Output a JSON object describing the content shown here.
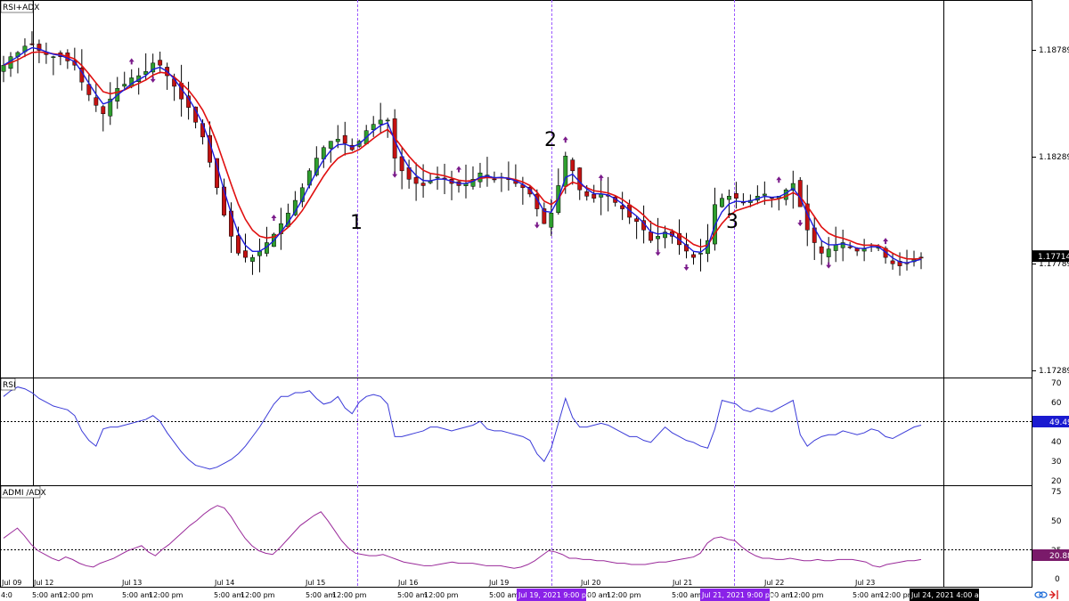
{
  "panels": {
    "main_title": "RSI+ADX",
    "rsi_title": "RSI",
    "adx_title": "ADMI /ADX"
  },
  "annotations": [
    "1",
    "2",
    "3"
  ],
  "colors": {
    "bull": "#2e9e2e",
    "bear": "#c31212",
    "fast_ma": "#1a1adc",
    "slow_ma": "#e01010",
    "rsi_line": "#3a3ad8",
    "adx_line": "#9a2a9a",
    "arrow": "#7a1a8a",
    "vline_dashed": "#9b59ff",
    "current_price_bg": "#000000",
    "rsi_value_bg": "#1a1ad0",
    "adx_value_bg": "#7a1a6a",
    "time_highlight_bg": "#8a22e8"
  },
  "time_axis": {
    "date_labels": [
      "Jul 09",
      "Jul 12",
      "Jul 13",
      "Jul 14",
      "Jul 15",
      "Jul 16",
      "Jul 19",
      "Jul 20",
      "Jul 21",
      "Jul 22",
      "Jul 23"
    ],
    "time_labels": [
      "4:0",
      "5:00 am",
      "12:00 pm",
      "5:00 am",
      "12:00 pm",
      "5:00 am",
      "12:00 pm",
      "5:00 am",
      "12:00 pm",
      "5:00 am",
      "12:00 pm",
      "5:00 am",
      "00 am",
      "12:00 pm",
      "5:00 am",
      "00 am",
      "12:00 pm",
      "5:00 am",
      "12:00 pm"
    ],
    "highlighted_times": [
      "Jul 19, 2021 9:00 pm",
      "Jul 21, 2021 9:00 pm",
      "Jul 24, 2021 4:00 am"
    ]
  },
  "chart_data": [
    {
      "type": "candlestick",
      "title": "RSI+ADX",
      "price_ticks": [
        1.18789,
        1.18289,
        1.17789,
        1.17289
      ],
      "current_price": 1.17714,
      "y_range": [
        1.1715,
        1.1892
      ],
      "closes": [
        1.1862,
        1.1866,
        1.1868,
        1.1871,
        1.1872,
        1.1869,
        1.1867,
        1.1866,
        1.1866,
        1.1864,
        1.1862,
        1.1854,
        1.1848,
        1.1843,
        1.1839,
        1.1846,
        1.1851,
        1.1853,
        1.1856,
        1.1857,
        1.1859,
        1.1863,
        1.1862,
        1.1857,
        1.1852,
        1.1846,
        1.1842,
        1.1835,
        1.1828,
        1.1816,
        1.1804,
        1.1791,
        1.1781,
        1.1773,
        1.1771,
        1.1771,
        1.1774,
        1.1778,
        1.1782,
        1.1787,
        1.1792,
        1.1798,
        1.1804,
        1.1812,
        1.1818,
        1.1823,
        1.1826,
        1.1827,
        1.1825,
        1.1822,
        1.1826,
        1.1831,
        1.1834,
        1.1836,
        1.1836,
        1.1818,
        1.1812,
        1.1808,
        1.1806,
        1.1805,
        1.1807,
        1.1809,
        1.1808,
        1.1806,
        1.1805,
        1.1806,
        1.1808,
        1.1811,
        1.181,
        1.1808,
        1.1809,
        1.1808,
        1.1806,
        1.1804,
        1.1801,
        1.1794,
        1.1787,
        1.1792,
        1.1805,
        1.1819,
        1.1812,
        1.1803,
        1.18,
        1.1799,
        1.1801,
        1.18,
        1.1797,
        1.1794,
        1.179,
        1.1788,
        1.1784,
        1.1779,
        1.1781,
        1.1783,
        1.1781,
        1.1777,
        1.1774,
        1.1771,
        1.1773,
        1.1779,
        1.1796,
        1.1799,
        1.18,
        1.1799,
        1.1797,
        1.1798,
        1.18,
        1.1801,
        1.1799,
        1.18,
        1.1803,
        1.1806,
        1.1795,
        1.1784,
        1.1778,
        1.1773,
        1.1775,
        1.1777,
        1.1778,
        1.1776,
        1.1774,
        1.1775,
        1.1777,
        1.1776,
        1.1771,
        1.1768,
        1.1767,
        1.1768,
        1.177,
        1.1771
      ],
      "markers": [
        {
          "i": 18,
          "dir": "up"
        },
        {
          "i": 21,
          "dir": "down"
        },
        {
          "i": 38,
          "dir": "up"
        },
        {
          "i": 55,
          "dir": "down"
        },
        {
          "i": 64,
          "dir": "up"
        },
        {
          "i": 75,
          "dir": "down"
        },
        {
          "i": 79,
          "dir": "up"
        },
        {
          "i": 84,
          "dir": "up"
        },
        {
          "i": 92,
          "dir": "down"
        },
        {
          "i": 96,
          "dir": "down"
        },
        {
          "i": 109,
          "dir": "up"
        },
        {
          "i": 112,
          "dir": "down"
        },
        {
          "i": 116,
          "dir": "down"
        },
        {
          "i": 124,
          "dir": "up"
        },
        {
          "i": 130,
          "dir": "up"
        }
      ]
    },
    {
      "type": "line",
      "title": "RSI",
      "y_ticks": [
        70,
        60,
        50,
        40,
        30,
        20
      ],
      "reference_level": 50,
      "current_value": 49.49,
      "ylim": [
        18,
        73
      ],
      "values": [
        64,
        67,
        69,
        68,
        66,
        63,
        61,
        59,
        58,
        57,
        54,
        46,
        41,
        38,
        47,
        48,
        48,
        49,
        50,
        51,
        52,
        54,
        51,
        45,
        40,
        35,
        31,
        28,
        27,
        26,
        27,
        29,
        31,
        34,
        38,
        43,
        48,
        54,
        60,
        64,
        64,
        66,
        66,
        67,
        63,
        60,
        61,
        64,
        58,
        55,
        61,
        64,
        65,
        64,
        60,
        43,
        43,
        44,
        45,
        46,
        48,
        48,
        47,
        46,
        47,
        48,
        49,
        51,
        47,
        46,
        46,
        45,
        44,
        43,
        41,
        34,
        30,
        37,
        50,
        63,
        53,
        48,
        48,
        49,
        50,
        49,
        47,
        45,
        43,
        43,
        41,
        40,
        44,
        48,
        45,
        43,
        41,
        40,
        38,
        37,
        47,
        62,
        61,
        60,
        57,
        56,
        58,
        57,
        56,
        58,
        60,
        62,
        44,
        38,
        41,
        43,
        44,
        44,
        46,
        45,
        44,
        45,
        47,
        46,
        43,
        42,
        44,
        46,
        48,
        49
      ]
    },
    {
      "type": "line",
      "title": "ADMI /ADX",
      "y_ticks": [
        75,
        50,
        25,
        0
      ],
      "reference_level": 25,
      "current_value": 20.88,
      "ylim": [
        0,
        78
      ],
      "values": [
        38,
        42,
        46,
        40,
        33,
        28,
        25,
        22,
        20,
        23,
        21,
        18,
        16,
        15,
        18,
        20,
        22,
        25,
        28,
        30,
        32,
        27,
        24,
        29,
        33,
        38,
        43,
        48,
        52,
        57,
        61,
        64,
        62,
        55,
        46,
        38,
        32,
        28,
        26,
        25,
        30,
        36,
        42,
        48,
        52,
        56,
        59,
        52,
        44,
        36,
        30,
        26,
        25,
        24,
        24,
        25,
        23,
        21,
        19,
        18,
        17,
        16,
        16,
        17,
        18,
        19,
        18,
        18,
        18,
        17,
        16,
        16,
        16,
        15,
        14,
        15,
        17,
        20,
        24,
        28,
        27,
        25,
        22,
        22,
        21,
        21,
        20,
        20,
        19,
        18,
        18,
        17,
        17,
        17,
        18,
        19,
        19,
        20,
        21,
        22,
        23,
        26,
        34,
        38,
        39,
        37,
        36,
        31,
        27,
        24,
        22,
        22,
        21,
        21,
        22,
        21,
        20,
        20,
        21,
        20,
        20,
        21,
        21,
        21,
        20,
        19,
        16,
        15,
        17,
        18,
        19,
        20,
        20,
        21
      ]
    }
  ]
}
